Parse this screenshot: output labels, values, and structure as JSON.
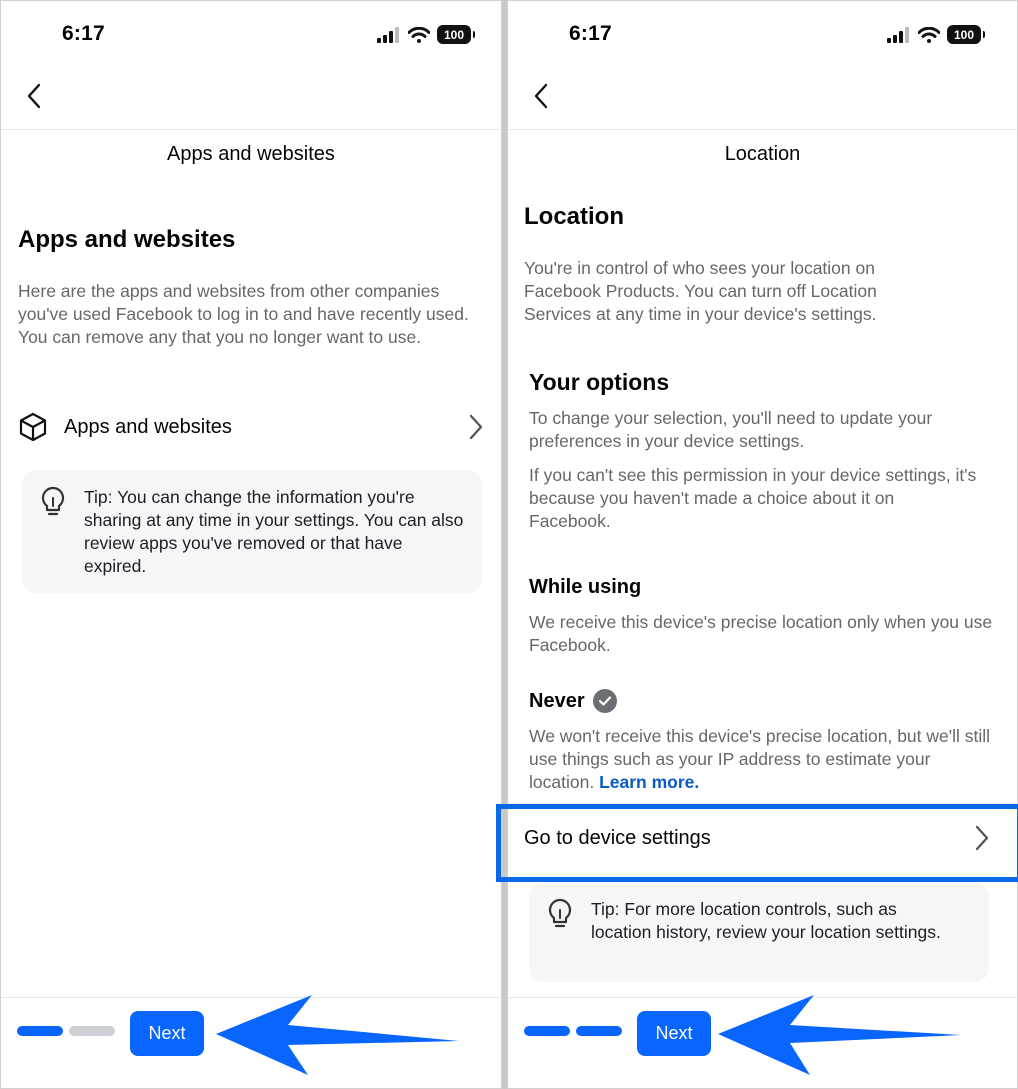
{
  "colors": {
    "accent": "#0866ff",
    "highlight": "#0a68e6",
    "muted_text": "#65676b",
    "link": "#0a5bc4"
  },
  "left": {
    "status": {
      "time": "6:17",
      "battery": "100"
    },
    "nav_title": "Apps and websites",
    "heading": "Apps and websites",
    "description": "Here are the apps and websites from other companies you've used Facebook to log in to and have recently used. You can remove any that you no longer want to use.",
    "row": {
      "label": "Apps and websites",
      "icon": "cube-icon"
    },
    "tip": {
      "text": "Tip: You can change the information you're sharing at any time in your settings. You can also review apps you've removed or that have expired.",
      "icon": "lightbulb-icon"
    },
    "footer": {
      "next_label": "Next",
      "progress_filled": 1,
      "progress_total": 2
    }
  },
  "right": {
    "status": {
      "time": "6:17",
      "battery": "100"
    },
    "nav_title": "Location",
    "heading": "Location",
    "description": "You're in control of who sees your location on Facebook Products. You can turn off Location Services at any time in your device's settings.",
    "options": {
      "heading": "Your options",
      "text1": "To change your selection, you'll need to update your preferences in your device settings.",
      "text2": "If you can't see this permission in your device settings, it's because you haven't made a choice about it on Facebook."
    },
    "while_using": {
      "heading": "While using",
      "text": "We receive this device's precise location only when you use Facebook."
    },
    "never": {
      "heading": "Never",
      "text": "We won't receive this device's precise location, but we'll still use things such as your IP address to estimate your location.",
      "link": "Learn more.",
      "selected": true
    },
    "device_settings_row": {
      "label": "Go to device settings"
    },
    "tip": {
      "text": "Tip: For more location controls, such as location history, review your location settings.",
      "icon": "lightbulb-icon"
    },
    "footer": {
      "next_label": "Next",
      "progress_filled": 2,
      "progress_total": 2
    }
  }
}
